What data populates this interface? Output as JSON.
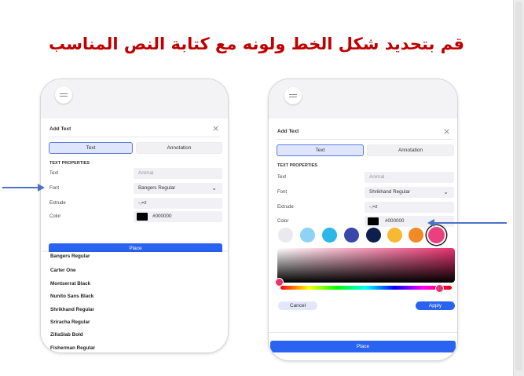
{
  "heading": "قم بتحديد شكل الخط ولونه مع كتابة النص المناسب",
  "left_phone": {
    "panel_title": "Add Text",
    "close_icon": "×",
    "tabs": [
      "Text",
      "Annotation"
    ],
    "section": "TEXT PROPERTIES",
    "rows": {
      "text_label": "Text",
      "text_placeholder": "Animal",
      "font_label": "Font",
      "font_value": "Bangers Regular",
      "extrude_label": "Extrude",
      "extrude_value": "-,=z",
      "color_label": "Color",
      "color_value": "#000000"
    },
    "place_label": "Place",
    "font_options": [
      "Bangers Regular",
      "Carter One",
      "Montserrat Black",
      "Nunito Sans Black",
      "Shrikhand Regular",
      "Sriracha Regular",
      "ZillaSlab Bold",
      "Fisherman Regular"
    ]
  },
  "right_phone": {
    "panel_title": "Add Text",
    "close_icon": "×",
    "tabs": [
      "Text",
      "Annotation"
    ],
    "section": "TEXT PROPERTIES",
    "rows": {
      "text_label": "Text",
      "text_placeholder": "Animal",
      "font_label": "Font",
      "font_value": "Shrikhand Regular",
      "extrude_label": "Extrude",
      "extrude_value": "-,=z",
      "color_label": "Color",
      "color_value": "#000000"
    },
    "swatches": [
      "#e9e9ee",
      "#8fd3f4",
      "#2bb7e8",
      "#3a46a8",
      "#0e1f4d",
      "#f6b931",
      "#f08a24",
      "#ec3f7f"
    ],
    "cancel_label": "Cancel",
    "apply_label": "Apply",
    "place_label": "Place"
  },
  "colors": {
    "heading": "#c00000",
    "accent": "#2a62f2",
    "arrow": "#4b72c8"
  }
}
